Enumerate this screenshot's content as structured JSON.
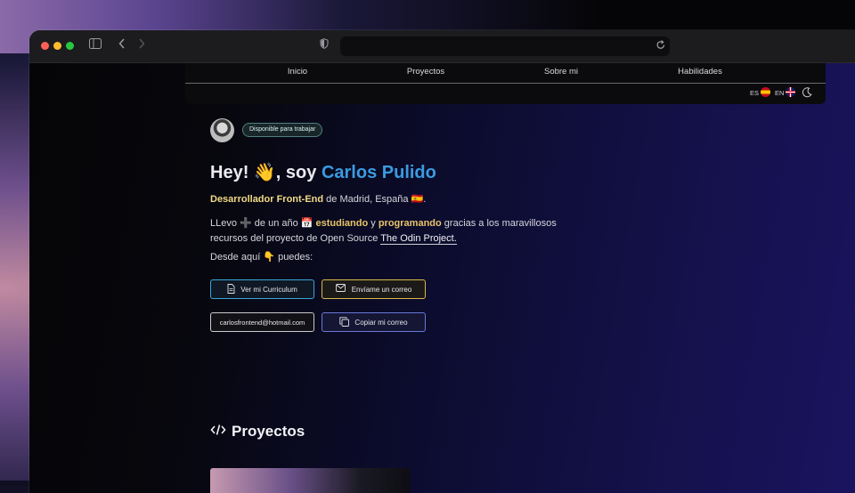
{
  "nav": {
    "links": [
      "Inicio",
      "Proyectos",
      "Sobre mi",
      "Habilidades"
    ],
    "lang_es": "ES",
    "lang_en": "EN"
  },
  "hero": {
    "badge": "Disponible para trabajar",
    "greeting": "Hey! 👋, soy ",
    "name": "Carlos Pulido",
    "role": "Desarrollador Front-End",
    "location": " de Madrid, España 🇪🇸.",
    "p1_a": "LLevo ➕ de un año 📅 ",
    "p1_b": "estudiando",
    "p1_c": " y ",
    "p1_d": "programando",
    "p1_e": " gracias a los maravillosos recursos del proyecto de Open Source ",
    "p1_link": "The Odin Project.",
    "p2": "Desde aquí 👇 puedes:"
  },
  "buttons": {
    "cv": "Ver mi Curriculum",
    "mail": "Envíame un correo",
    "address": "carlosfrontend@hotmail.com",
    "copy": "Copiar mi correo"
  },
  "projects": {
    "title": "Proyectos"
  },
  "colors": {
    "accent_name": "#3a9be0",
    "highlight": "#e8c46a",
    "cv_border": "#3aa6d8",
    "mail_border": "#d8b84a",
    "copy_border": "#6a78d8"
  }
}
